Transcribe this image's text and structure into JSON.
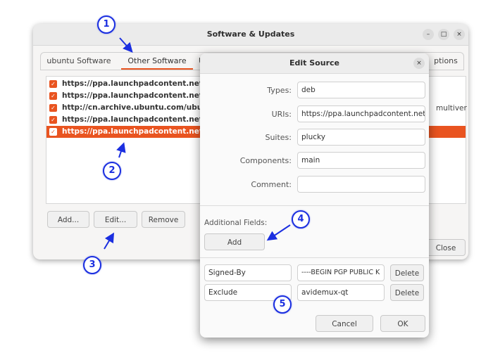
{
  "window": {
    "title": "Software & Updates",
    "controls": {
      "minimize": "–",
      "maximize": "□",
      "close": "×"
    },
    "tabs": [
      {
        "label": "ubuntu Software"
      },
      {
        "label": "Other Software"
      },
      {
        "label": "U"
      },
      {
        "label": "ptions"
      }
    ],
    "sources": [
      {
        "checked": true,
        "text": "https://ppa.launchpadcontent.net/dan"
      },
      {
        "checked": true,
        "text": "https://ppa.launchpadcontent.net/qbi"
      },
      {
        "checked": true,
        "text": "http://cn.archive.ubuntu.com/ubuntu/"
      },
      {
        "checked": true,
        "text": "https://ppa.launchpadcontent.net/ubu"
      },
      {
        "checked": true,
        "selected": true,
        "text": "https://ppa.launchpadcontent.net/xtra"
      }
    ],
    "right_peek_text": "multiver",
    "buttons": {
      "add": "Add...",
      "edit": "Edit...",
      "remove": "Remove",
      "close": "Close"
    }
  },
  "dialog": {
    "title": "Edit Source",
    "close": "×",
    "fields": {
      "types": {
        "label": "Types:",
        "value": "deb"
      },
      "uris": {
        "label": "URIs:",
        "value": "https://ppa.launchpadcontent.net/"
      },
      "suites": {
        "label": "Suites:",
        "value": "plucky"
      },
      "components": {
        "label": "Components:",
        "value": "main"
      },
      "comment": {
        "label": "Comment:",
        "value": ""
      }
    },
    "additional_fields_label": "Additional Fields:",
    "add_button": "Add",
    "extra_rows": [
      {
        "key": "Signed-By",
        "value": "----BEGIN PGP PUBLIC K",
        "delete": "Delete"
      },
      {
        "key": "Exclude",
        "value": "avidemux-qt",
        "delete": "Delete"
      }
    ],
    "cancel": "Cancel",
    "ok": "OK"
  },
  "annotations": [
    "1",
    "2",
    "3",
    "4",
    "5"
  ],
  "annotation_color": "#1b2fe0",
  "accent_color": "#e95420"
}
